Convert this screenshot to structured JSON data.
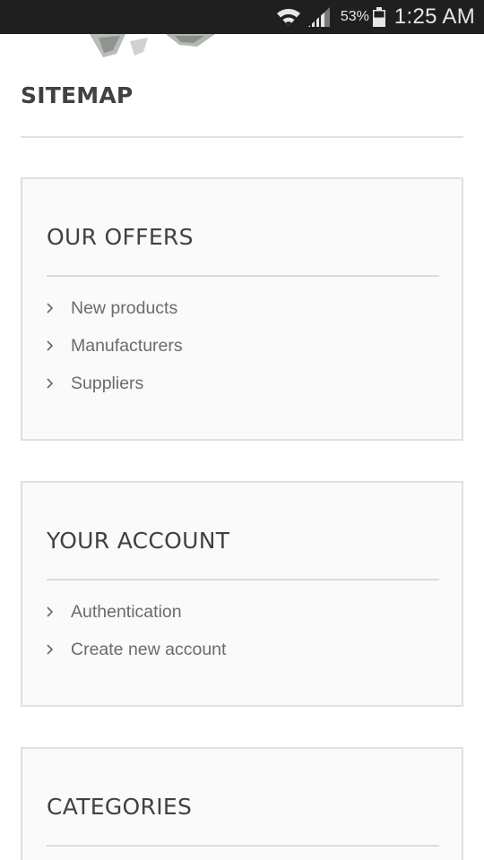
{
  "status_bar": {
    "battery_percent": "53%",
    "time": "1:25 AM",
    "icons": [
      "wifi-icon",
      "signal-icon",
      "battery-icon"
    ]
  },
  "page": {
    "title": "SITEMAP"
  },
  "sections": [
    {
      "title": "OUR OFFERS",
      "links": [
        "New products",
        "Manufacturers",
        "Suppliers"
      ]
    },
    {
      "title": "YOUR ACCOUNT",
      "links": [
        "Authentication",
        "Create new account"
      ]
    },
    {
      "title": "CATEGORIES",
      "links": []
    }
  ],
  "colors": {
    "status_bar_bg": "#1f1f1f",
    "block_bg": "#fafafa",
    "block_border": "#e0e0e0",
    "heading_text": "#414141",
    "link_text": "#6b6b6b"
  }
}
